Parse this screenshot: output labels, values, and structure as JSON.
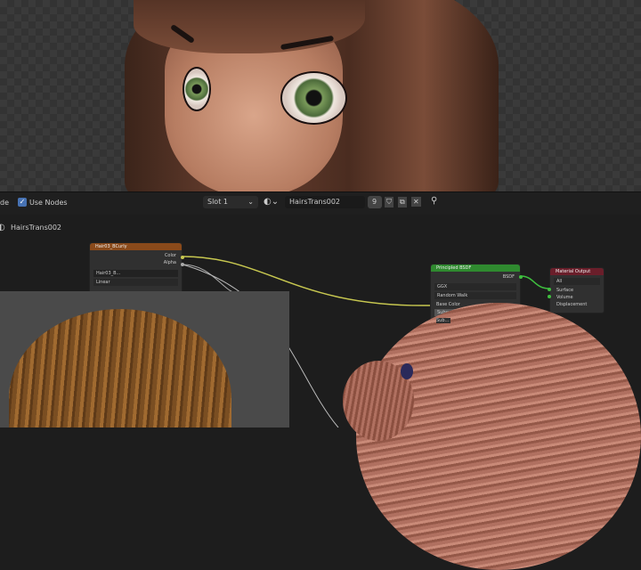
{
  "header": {
    "mode_fragment": "de",
    "use_nodes_label": "Use Nodes",
    "use_nodes_checked": true,
    "slot": "Slot 1",
    "material_name": "HairsTrans002",
    "users_count": "9"
  },
  "breadcrumb": "HairsTrans002",
  "nodes": {
    "image_texture": {
      "title": "Hair03_BCurly",
      "outputs": [
        "Color",
        "Alpha"
      ],
      "image": "Hair03_B...",
      "interpolation": "Linear"
    },
    "principled": {
      "title": "Principled BSDF",
      "output": "BSDF",
      "distribution": "GGX",
      "subsurface_method": "Random Walk",
      "inputs": [
        "Base Color",
        "Subsurface",
        "Sub..."
      ]
    },
    "output": {
      "title": "Material Output",
      "target": "All",
      "inputs": [
        "Surface",
        "Volume",
        "Displacement"
      ]
    }
  },
  "colors": {
    "texture_header": "#8a4a1a",
    "shader_header": "#2f8a2f",
    "output_header": "#6a1e2a",
    "accent": "#4772b3"
  }
}
